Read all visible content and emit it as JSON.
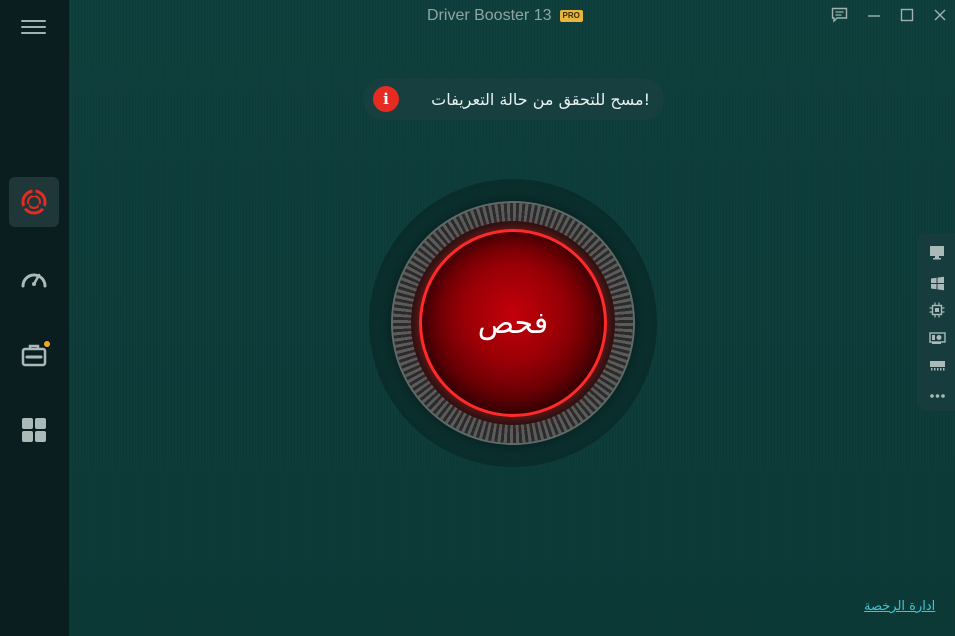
{
  "window": {
    "title": "Driver Booster 13",
    "edition_badge": "PRO",
    "controls": [
      "feedback-icon",
      "minimize-icon",
      "maximize-icon",
      "close-icon"
    ]
  },
  "sidebar": {
    "menu_icon": "hamburger-icon",
    "items": [
      {
        "id": "scan",
        "icon": "lifebuoy-icon",
        "active": true
      },
      {
        "id": "boost",
        "icon": "speedometer-icon",
        "active": false
      },
      {
        "id": "toolbox",
        "icon": "toolbox-icon",
        "active": false,
        "has_notification": true
      },
      {
        "id": "action-center",
        "icon": "grid-icon",
        "active": false
      }
    ]
  },
  "notice": {
    "icon": "info-icon",
    "icon_glyph": "i",
    "text": "!مسح للتحقق من حالة التعريفات"
  },
  "scan_button": {
    "label": "فحص"
  },
  "device_panel": {
    "icons": [
      "monitor-icon",
      "windows-icon",
      "cpu-icon",
      "graphics-card-icon",
      "memory-icon",
      "more-icon"
    ]
  },
  "footer": {
    "license_link": "ادارة الرخصة"
  },
  "colors": {
    "background": "#0d3b38",
    "sidebar": "#0a1d1f",
    "accent_red": "#e52b22",
    "scan_ring": "#ff2a2a",
    "pro_badge": "#e8b53d",
    "link": "#3fc4d6"
  }
}
